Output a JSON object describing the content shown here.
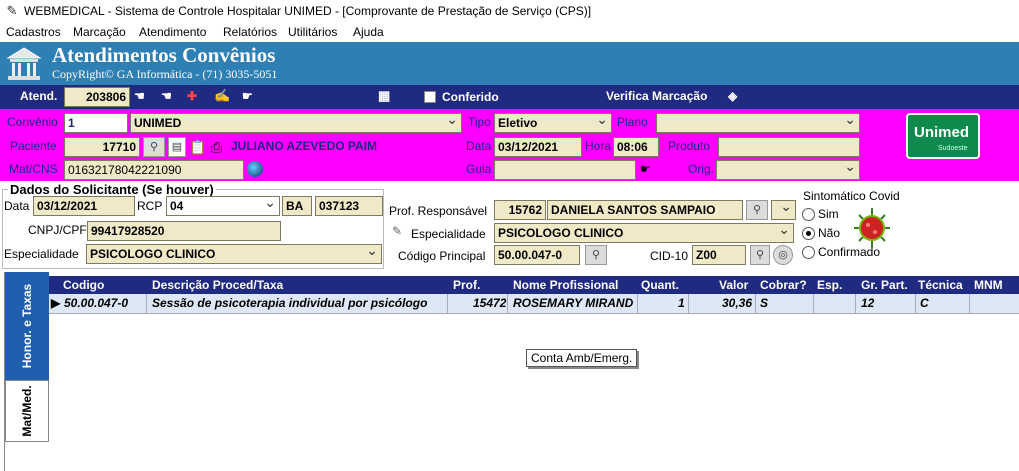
{
  "window": {
    "title": "WEBMEDICAL - Sistema de Controle Hospitalar UNIMED - [Comprovante de Prestação de Serviço  (CPS)]"
  },
  "menu": [
    "Cadastros",
    "Marcação",
    "Atendimento",
    "Relatórios",
    "Utilitários",
    "Ajuda"
  ],
  "banner": {
    "title": "Atendimentos Convênios",
    "copyright": "CopyRight© GA Informática - (71) 3035-5051"
  },
  "toolbar": {
    "atend_label": "Atend.",
    "atend_value": "203806",
    "conferido_label": "Conferido",
    "verifica_label": "Verifica Marcação"
  },
  "patient": {
    "convenio_label": "Convênio",
    "convenio_code": "1",
    "convenio_name": "UNIMED",
    "tipo_label": "Tipo",
    "tipo_value": "Eletivo",
    "plano_label": "Plano",
    "plano_value": "",
    "paciente_label": "Paciente",
    "paciente_code": "17710",
    "paciente_name": "JULIANO AZEVEDO PAIM",
    "data_label": "Data",
    "data_value": "03/12/2021",
    "hora_label": "Hora",
    "hora_value": "08:06",
    "produto_label": "Produto",
    "produto_value": "",
    "matcns_label": "Mat/CNS",
    "matcns_value": "01632178042221090",
    "guia_label": "Guia",
    "guia_value": "",
    "orig_label": "Orig.",
    "orig_value": "",
    "logo_brand": "Unimed",
    "logo_sub": "Sudoeste"
  },
  "solicitante": {
    "title": "Dados do Solicitante (Se houver)",
    "data_label": "Data",
    "data_value": "03/12/2021",
    "rcp_label": "RCP",
    "rcp_value": "04",
    "uf_value": "BA",
    "rcp_num": "037123",
    "cnpj_label": "CNPJ/CPF",
    "cnpj_value": "99417928520",
    "esp_label": "Especialidade",
    "esp_value": "PSICOLOGO CLINICO"
  },
  "profissional": {
    "resp_label": "Prof. Responsável",
    "resp_code": "15762",
    "resp_name": "DANIELA SANTOS SAMPAIO",
    "esp_label": "Especialidade",
    "esp_value": "PSICOLOGO CLINICO",
    "cod_label": "Código Principal",
    "cod_value": "50.00.047-0",
    "cid_label": "CID-10",
    "cid_value": "Z00"
  },
  "sintomatico": {
    "title": "Sintomático Covid",
    "options": [
      "Sim",
      "Não",
      "Confirmado"
    ],
    "selected": "Não"
  },
  "tabs": [
    "Honor. e Taxas",
    "Mat/Med."
  ],
  "grid": {
    "headers": [
      "Codigo",
      "Descrição Proced/Taxa",
      "Prof.",
      "Nome Profissional",
      "Quant.",
      "Valor",
      "Cobrar?",
      "Esp.",
      "Gr. Part.",
      "Técnica",
      "MNM"
    ],
    "rows": [
      {
        "codigo": "50.00.047-0",
        "descricao": "Sessão de psicoterapia individual por psicólogo",
        "prof": "15472",
        "nome": "ROSEMARY MIRAND",
        "quant": "1",
        "valor": "30,36",
        "cobrar": "S",
        "esp": "",
        "grpart": "12",
        "tecnica": "C",
        "mnm": ""
      }
    ]
  },
  "tooltip": "Conta Amb/Emerg."
}
